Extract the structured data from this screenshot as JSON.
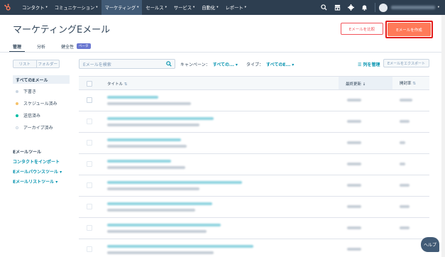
{
  "nav": {
    "items": [
      {
        "label": "コンタクト"
      },
      {
        "label": "コミュニケーション"
      },
      {
        "label": "マーケティング"
      },
      {
        "label": "セールス"
      },
      {
        "label": "サービス"
      },
      {
        "label": "自動化"
      },
      {
        "label": "レポート"
      }
    ],
    "active_index": 2
  },
  "header": {
    "title": "マーケティングEメール",
    "compare_button": "Eメールを比較",
    "create_button": "Eメールを作成"
  },
  "tabs": [
    {
      "label": "管理"
    },
    {
      "label": "分析"
    },
    {
      "label": "健全性",
      "badge": "ベータ"
    }
  ],
  "sidebar": {
    "toggle": [
      "リスト",
      "フォルダー"
    ],
    "all_label": "すべてのEメール",
    "statuses": [
      {
        "label": "下書き",
        "color": "#cbd6e2"
      },
      {
        "label": "スケジュール済み",
        "color": "#f5c26b"
      },
      {
        "label": "送信済み",
        "color": "#00bda5"
      },
      {
        "label": "アーカイブ済み",
        "color": "#ffffff"
      }
    ],
    "tools_heading": "Eメールツール",
    "tools": [
      {
        "label": "コンタクトをインポート"
      },
      {
        "label": "Eメールバウンスツール",
        "caret": "▾"
      },
      {
        "label": "Eメールリストツール",
        "caret": "▾"
      }
    ]
  },
  "filters": {
    "search_placeholder": "Eメールを検索",
    "campaign_label": "キャンペーン：",
    "campaign_value": "すべての...",
    "type_label": "タイプ：",
    "type_value": "すべてのE...",
    "manage_columns": "列を管理",
    "export_button": "Eメールをエクスポート"
  },
  "table": {
    "columns": {
      "title": "タイトル",
      "last_updated": "最終更新",
      "open_rate": "開封率"
    }
  },
  "help_button": "ヘルプ",
  "colors": {
    "nav_bg": "#2d3e50",
    "accent": "#ff7a59",
    "link": "#0091ae",
    "highlight_outline": "#e41c1c"
  }
}
